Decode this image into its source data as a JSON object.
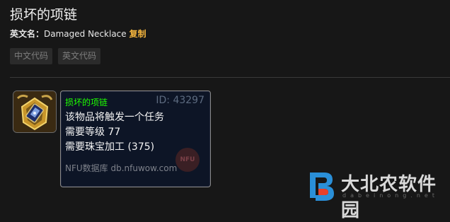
{
  "header": {
    "title": "损坏的项链",
    "en_label": "英文名：",
    "en_name": "Damaged Necklace",
    "copy_label": "复制"
  },
  "buttons": [
    {
      "label": "中文代码"
    },
    {
      "label": "英文代码"
    }
  ],
  "tooltip": {
    "name": "损坏的项链",
    "id": "ID: 43297",
    "lines": [
      "该物品将触发一个任务",
      "需要等级 77",
      "需要珠宝加工 (375)"
    ],
    "source": "NFU数据库 db.nfuwow.com",
    "badge": "NFU"
  },
  "colors": {
    "item_name": "#1eff00",
    "copy_link": "#f2b33d",
    "tooltip_bg": "#0d1526"
  },
  "watermark": {
    "text": "大北农软件园",
    "url": "dabeinong.net"
  }
}
